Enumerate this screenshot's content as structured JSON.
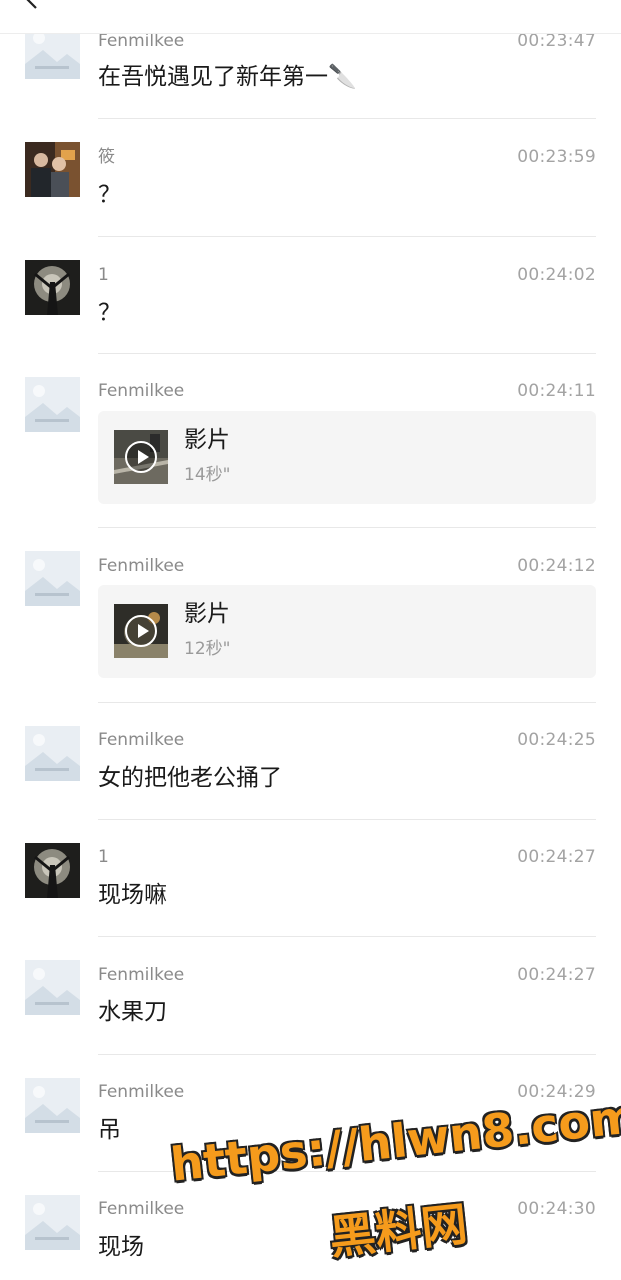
{
  "messages": [
    {
      "sender": "Fenmilkee",
      "time": "00:23:47",
      "kind": "text",
      "text": "在吾悦遇见了新年第一🔪",
      "avatar": "placeholder-avatar"
    },
    {
      "sender": "筱",
      "time": "00:23:59",
      "kind": "text",
      "text": "？",
      "avatar": "couple-photo-avatar"
    },
    {
      "sender": "1",
      "time": "00:24:02",
      "kind": "text",
      "text": "？",
      "avatar": "dark-figure-avatar"
    },
    {
      "sender": "Fenmilkee",
      "time": "00:24:11",
      "kind": "video",
      "video_title": "影片",
      "video_duration": "14秒\"",
      "avatar": "placeholder-avatar"
    },
    {
      "sender": "Fenmilkee",
      "time": "00:24:12",
      "kind": "video",
      "video_title": "影片",
      "video_duration": "12秒\"",
      "avatar": "placeholder-avatar"
    },
    {
      "sender": "Fenmilkee",
      "time": "00:24:25",
      "kind": "text",
      "text": "女的把他老公捅了",
      "avatar": "placeholder-avatar"
    },
    {
      "sender": "1",
      "time": "00:24:27",
      "kind": "text",
      "text": "现场嘛",
      "avatar": "dark-figure-avatar"
    },
    {
      "sender": "Fenmilkee",
      "time": "00:24:27",
      "kind": "text",
      "text": "水果刀",
      "avatar": "placeholder-avatar"
    },
    {
      "sender": "Fenmilkee",
      "time": "00:24:29",
      "kind": "text",
      "text": "吊",
      "avatar": "placeholder-avatar"
    },
    {
      "sender": "Fenmilkee",
      "time": "00:24:30",
      "kind": "text",
      "text": "现场",
      "avatar": "placeholder-avatar"
    }
  ],
  "watermark": {
    "url": "https://hlwn8.com",
    "name": "黑料网"
  },
  "colors": {
    "watermark_fill": "#f59b1c",
    "watermark_outline": "#222222",
    "card_bg": "#f5f5f5"
  }
}
